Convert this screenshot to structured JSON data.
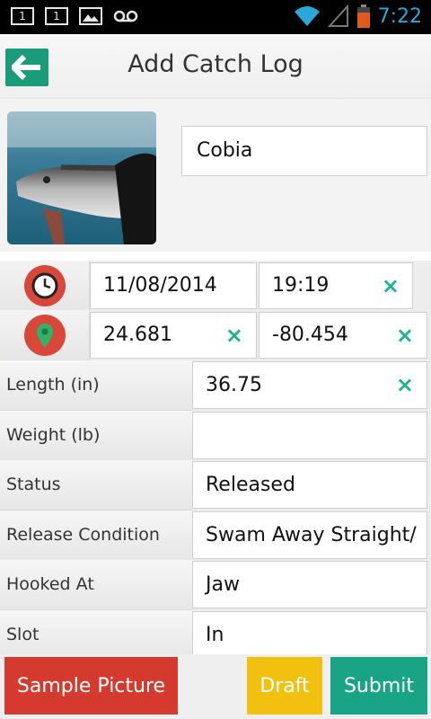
{
  "status_bar": {
    "time": "7:22",
    "left_icons": [
      "notification-1-icon",
      "notification-1-icon",
      "image-icon",
      "voicemail-icon"
    ],
    "right_icons": [
      "wifi-icon",
      "signal-icon",
      "battery-icon"
    ],
    "notif_digit": "1"
  },
  "action_bar": {
    "title": "Add Catch Log",
    "back_icon": "back-arrow-icon",
    "accent": "#1a9b79"
  },
  "catch": {
    "species": "Cobia",
    "photo_icon": "fish-photo"
  },
  "datetime": {
    "icon": "clock-icon",
    "date": "11/08/2014",
    "time": "19:19",
    "clear": "×"
  },
  "location": {
    "icon": "map-pin-icon",
    "latitude": "24.681",
    "longitude": "-80.454",
    "clear": "×"
  },
  "fields": [
    {
      "label": "Length (in)",
      "value": "36.75",
      "clear": "×"
    },
    {
      "label": "Weight (lb)",
      "value": ""
    },
    {
      "label": "Status",
      "value": "Released"
    },
    {
      "label": "Release Condition",
      "value": "Swam Away Straight/"
    },
    {
      "label": "Hooked At",
      "value": "Jaw"
    },
    {
      "label": "Slot",
      "value": "In"
    }
  ],
  "buttons": {
    "sample": "Sample Picture",
    "draft": "Draft",
    "submit": "Submit"
  },
  "colors": {
    "red": "#d43b2e",
    "yellow": "#f2c10f",
    "green": "#19a585",
    "clear_x": "#1ab394"
  }
}
